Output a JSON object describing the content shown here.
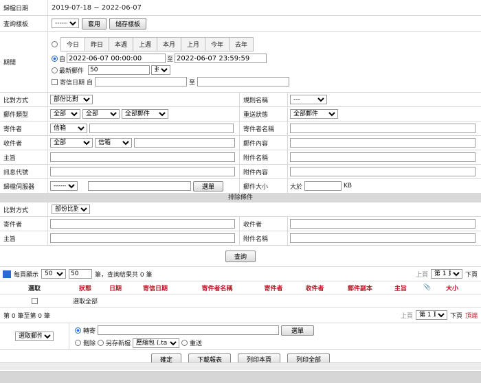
{
  "archive_date": {
    "label": "歸檔日期",
    "value": "2019-07-18 ~ 2022-06-07"
  },
  "query_template": {
    "label": "查詢樣板",
    "select": "-------",
    "apply": "套用",
    "save": "儲存樣板"
  },
  "period": {
    "label": "期間",
    "tabs": [
      "今日",
      "昨日",
      "本週",
      "上週",
      "本月",
      "上月",
      "今年",
      "去年"
    ],
    "from_label": "自",
    "from": "2022-06-07 00:00:00",
    "to_label": "至",
    "to": "2022-06-07 23:59:59",
    "latest_label": "最新郵件",
    "latest_count": "50",
    "latest_unit": "封",
    "send_date_label": "寄信日期",
    "send_from_label": "自",
    "send_to_label": "至"
  },
  "compare_mode": {
    "label": "比對方式",
    "value": "部份比對"
  },
  "rule_name": {
    "label": "規則名稱",
    "value": "---"
  },
  "mail_type": {
    "label": "郵件類型",
    "v1": "全部",
    "v2": "全部",
    "v3": "全部郵件"
  },
  "resend_status": {
    "label": "重送狀態",
    "value": "全部郵件"
  },
  "sender": {
    "label": "寄件者",
    "field": "信箱"
  },
  "sender_name": {
    "label": "寄件者名稱"
  },
  "recipient": {
    "label": "收件者",
    "v1": "全部",
    "v2": "信箱"
  },
  "mail_content": {
    "label": "郵件內容"
  },
  "subject": {
    "label": "主旨"
  },
  "attachment_name": {
    "label": "附件名稱"
  },
  "message_id": {
    "label": "訊息代號"
  },
  "attachment_content": {
    "label": "附件內容"
  },
  "archive_server": {
    "label": "歸檔伺服器",
    "value": "-------",
    "button": "選單"
  },
  "mail_size": {
    "label": "郵件大小",
    "prefix": "大於",
    "unit": "KB"
  },
  "exclude": {
    "title": "排除條件",
    "compare_label": "比對方式",
    "compare_value": "部份比對",
    "sender_label": "寄件者",
    "recipient_label": "收件者",
    "subject_label": "主旨",
    "attach_label": "附件名稱"
  },
  "query_button": "查詢",
  "results": {
    "per_page_label": "每頁顯示",
    "per_page": "50",
    "per_page_input": "50",
    "summary": "筆，查詢結果共 0 筆",
    "prev": "上頁",
    "page": "第 1 頁",
    "next": "下頁",
    "last": "頂端",
    "columns": [
      "選取",
      "狀態",
      "日期",
      "寄信日期",
      "寄件者名稱",
      "寄件者",
      "收件者",
      "郵件副本",
      "主旨",
      "📎",
      "大小"
    ],
    "select_all": "選取全部",
    "range": "第 0 筆至第 0 筆"
  },
  "actions": {
    "select_mail": "選取郵件",
    "forward": "轉寄",
    "menu": "選單",
    "delete": "刪除",
    "save_new": "另存新檔",
    "archive_format": "壓縮包 (.tar)",
    "resend": "重送",
    "confirm": "確定",
    "download": "下載報表",
    "print_page": "列印本頁",
    "print_all": "列印全部"
  }
}
